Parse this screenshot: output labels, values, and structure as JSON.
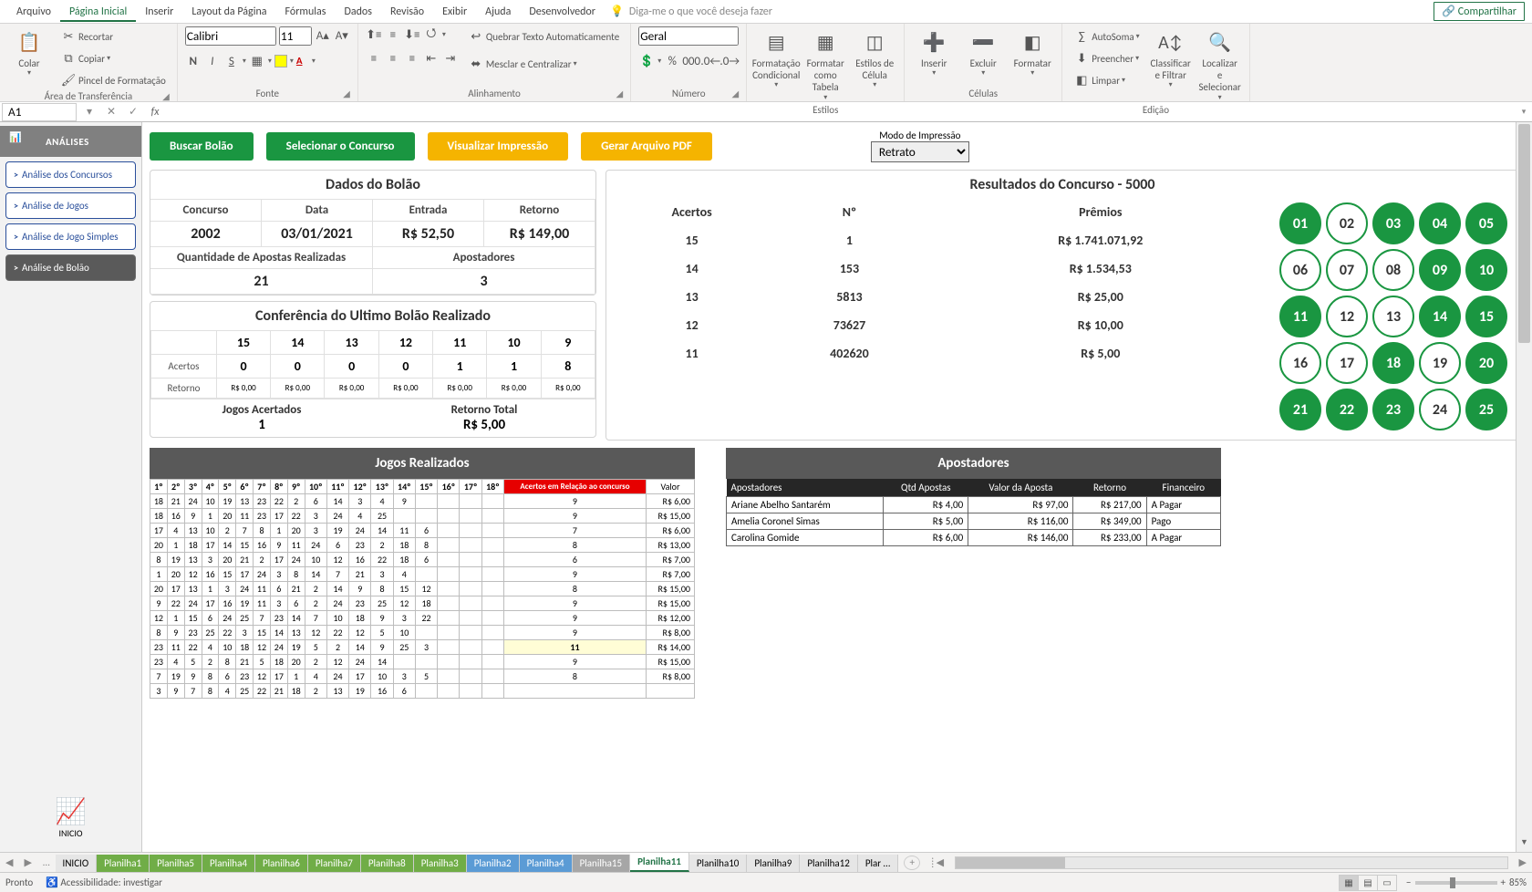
{
  "menubar": {
    "tabs": [
      "Arquivo",
      "Página Inicial",
      "Inserir",
      "Layout da Página",
      "Fórmulas",
      "Dados",
      "Revisão",
      "Exibir",
      "Ajuda",
      "Desenvolvedor"
    ],
    "active": 1,
    "tellme": "Diga-me o que você deseja fazer",
    "share": "Compartilhar"
  },
  "ribbon": {
    "paste": "Colar",
    "cut": "Recortar",
    "copy": "Copiar",
    "fmtpaint": "Pincel de Formatação",
    "grp_clipboard": "Área de Transferência",
    "font_name": "Calibri",
    "font_size": "11",
    "grp_font": "Fonte",
    "wrap": "Quebrar Texto Automaticamente",
    "merge": "Mesclar e Centralizar",
    "grp_align": "Alinhamento",
    "numfmt": "Geral",
    "grp_number": "Número",
    "condfmt": "Formatação Condicional",
    "fmttable": "Formatar como Tabela",
    "cellstyle": "Estilos de Célula",
    "grp_styles": "Estilos",
    "insert": "Inserir",
    "delete": "Excluir",
    "format": "Formatar",
    "grp_cells": "Células",
    "autosum": "AutoSoma",
    "fill": "Preencher",
    "clear": "Limpar",
    "sortfilter": "Classificar e Filtrar",
    "findsel": "Localizar e Selecionar",
    "grp_edit": "Edição"
  },
  "formula": {
    "namebox": "A1"
  },
  "sidebar": {
    "title": "ANÁLISES",
    "items": [
      "Análise dos Concursos",
      "Análise de Jogos",
      "Análise de Jogo Simples",
      "Análise de Bolão"
    ],
    "active": 3,
    "inicio": "INICIO"
  },
  "toprow": {
    "buscar": "Buscar Bolão",
    "selecionar": "Selecionar o Concurso",
    "visualizar": "Visualizar Impressão",
    "gerar": "Gerar Arquivo PDF",
    "printmode_label": "Modo de Impressão",
    "printmode_value": "Retrato"
  },
  "bolao": {
    "title": "Dados do Bolão",
    "h_concurso": "Concurso",
    "v_concurso": "2002",
    "h_data": "Data",
    "v_data": "03/01/2021",
    "h_entrada": "Entrada",
    "v_entrada": "R$ 52,50",
    "h_retorno": "Retorno",
    "v_retorno": "R$ 149,00",
    "h_qtd": "Quantidade de Apostas Realizadas",
    "v_qtd": "21",
    "h_apost": "Apostadores",
    "v_apost": "3"
  },
  "conf": {
    "title": "Conferência do Ultimo Bolão Realizado",
    "cols": [
      "15",
      "14",
      "13",
      "12",
      "11",
      "10",
      "9"
    ],
    "row_acertos_label": "Acertos",
    "row_acertos": [
      "0",
      "0",
      "0",
      "0",
      "1",
      "1",
      "8"
    ],
    "row_retorno_label": "Retorno",
    "row_retorno": [
      "R$ 0,00",
      "R$ 0,00",
      "R$ 0,00",
      "R$ 0,00",
      "R$ 0,00",
      "R$ 0,00",
      "R$ 0,00"
    ],
    "foot1_t": "Jogos Acertados",
    "foot1_v": "1",
    "foot2_t": "Retorno Total",
    "foot2_v": "R$ 5,00"
  },
  "result": {
    "title": "Resultados do Concurso - 5000",
    "h_acertos": "Acertos",
    "h_num": "Nº",
    "h_premios": "Prêmios",
    "rows": [
      {
        "a": "15",
        "n": "1",
        "p": "R$ 1.741.071,92"
      },
      {
        "a": "14",
        "n": "153",
        "p": "R$ 1.534,53"
      },
      {
        "a": "13",
        "n": "5813",
        "p": "R$ 25,00"
      },
      {
        "a": "12",
        "n": "73627",
        "p": "R$ 10,00"
      },
      {
        "a": "11",
        "n": "402620",
        "p": "R$ 5,00"
      }
    ],
    "balls_on": [
      1,
      3,
      4,
      5,
      9,
      10,
      11,
      14,
      15,
      18,
      20,
      21,
      22,
      23,
      25
    ]
  },
  "jogos": {
    "title": "Jogos Realizados",
    "ordinals": [
      "1º",
      "2º",
      "3º",
      "4º",
      "5º",
      "6º",
      "7º",
      "8º",
      "9º",
      "10º",
      "11º",
      "12º",
      "13º",
      "14º",
      "15º",
      "16º",
      "17º",
      "18º"
    ],
    "redhdr": "Acertos em Relação ao concurso",
    "valhdr": "Valor",
    "rows": [
      {
        "n": [
          "18",
          "21",
          "24",
          "10",
          "19",
          "13",
          "23",
          "22",
          "2",
          "6",
          "14",
          "3",
          "4",
          "9",
          "",
          "",
          "",
          ""
        ],
        "a": "9",
        "v": "R$ 6,00"
      },
      {
        "n": [
          "18",
          "16",
          "9",
          "1",
          "20",
          "11",
          "23",
          "17",
          "22",
          "3",
          "24",
          "4",
          "25",
          "",
          "",
          "",
          "",
          ""
        ],
        "a": "9",
        "v": "R$ 15,00"
      },
      {
        "n": [
          "17",
          "4",
          "13",
          "10",
          "2",
          "7",
          "8",
          "1",
          "20",
          "3",
          "19",
          "24",
          "14",
          "11",
          "6",
          "",
          "",
          ""
        ],
        "a": "7",
        "v": "R$ 6,00"
      },
      {
        "n": [
          "20",
          "1",
          "18",
          "17",
          "14",
          "15",
          "16",
          "9",
          "11",
          "24",
          "6",
          "23",
          "2",
          "18",
          "8",
          "",
          "",
          ""
        ],
        "a": "8",
        "v": "R$ 13,00"
      },
      {
        "n": [
          "8",
          "19",
          "13",
          "3",
          "20",
          "21",
          "2",
          "17",
          "24",
          "10",
          "12",
          "16",
          "22",
          "18",
          "6",
          "",
          "",
          ""
        ],
        "a": "6",
        "v": "R$ 7,00"
      },
      {
        "n": [
          "1",
          "20",
          "12",
          "16",
          "15",
          "17",
          "24",
          "3",
          "8",
          "14",
          "7",
          "21",
          "3",
          "4",
          "",
          "",
          "",
          ""
        ],
        "a": "9",
        "v": "R$ 7,00"
      },
      {
        "n": [
          "20",
          "17",
          "13",
          "1",
          "3",
          "24",
          "11",
          "6",
          "21",
          "2",
          "14",
          "9",
          "8",
          "15",
          "12",
          "",
          "",
          ""
        ],
        "a": "8",
        "v": "R$ 15,00"
      },
      {
        "n": [
          "9",
          "22",
          "24",
          "17",
          "16",
          "19",
          "11",
          "3",
          "6",
          "2",
          "24",
          "23",
          "25",
          "12",
          "18",
          "",
          "",
          ""
        ],
        "a": "9",
        "v": "R$ 15,00"
      },
      {
        "n": [
          "12",
          "1",
          "15",
          "6",
          "24",
          "25",
          "7",
          "23",
          "14",
          "7",
          "10",
          "18",
          "9",
          "3",
          "22",
          "",
          "",
          ""
        ],
        "a": "9",
        "v": "R$ 12,00"
      },
      {
        "n": [
          "8",
          "9",
          "23",
          "25",
          "22",
          "3",
          "15",
          "14",
          "13",
          "12",
          "22",
          "12",
          "5",
          "10",
          "",
          "",
          "",
          ""
        ],
        "a": "9",
        "v": "R$ 8,00"
      },
      {
        "n": [
          "23",
          "11",
          "22",
          "4",
          "10",
          "18",
          "12",
          "24",
          "19",
          "5",
          "2",
          "14",
          "9",
          "25",
          "3",
          "",
          "",
          ""
        ],
        "a": "11",
        "v": "R$ 14,00",
        "hl": true
      },
      {
        "n": [
          "23",
          "4",
          "5",
          "2",
          "8",
          "21",
          "5",
          "18",
          "20",
          "2",
          "12",
          "24",
          "14",
          "",
          "",
          "",
          "",
          ""
        ],
        "a": "9",
        "v": "R$ 15,00"
      },
      {
        "n": [
          "7",
          "19",
          "9",
          "8",
          "6",
          "23",
          "12",
          "17",
          "1",
          "4",
          "24",
          "17",
          "10",
          "3",
          "5",
          "",
          "",
          ""
        ],
        "a": "8",
        "v": "R$ 8,00"
      },
      {
        "n": [
          "3",
          "9",
          "7",
          "8",
          "4",
          "25",
          "22",
          "21",
          "18",
          "2",
          "13",
          "19",
          "16",
          "6",
          "",
          "",
          "",
          ""
        ],
        "a": "",
        "v": ""
      }
    ]
  },
  "apost": {
    "title": "Apostadores",
    "headers": [
      "Apostadores",
      "Qtd Apostas",
      "Valor da Aposta",
      "Retorno",
      "Financeiro"
    ],
    "rows": [
      {
        "nome": "Ariane Abelho Santarém",
        "qtd": "",
        "val": "R$ 4,00",
        "ret_ap": "R$ 97,00",
        "ret": "R$ 217,00",
        "fin": "A Pagar"
      },
      {
        "nome": "Amelia Coronel Simas",
        "qtd": "",
        "val": "R$ 5,00",
        "ret_ap": "R$ 116,00",
        "ret": "R$ 349,00",
        "fin": "Pago"
      },
      {
        "nome": "Carolina Gomide",
        "qtd": "",
        "val": "R$ 6,00",
        "ret_ap": "R$ 146,00",
        "ret": "R$ 233,00",
        "fin": "A Pagar"
      }
    ]
  },
  "sheets": {
    "tabs": [
      {
        "name": "INICIO",
        "color": ""
      },
      {
        "name": "Planilha1",
        "color": "green"
      },
      {
        "name": "Planilha5",
        "color": "green"
      },
      {
        "name": "Planilha4",
        "color": "green"
      },
      {
        "name": "Planilha6",
        "color": "green"
      },
      {
        "name": "Planilha7",
        "color": "green"
      },
      {
        "name": "Planilha8",
        "color": "green"
      },
      {
        "name": "Planilha3",
        "color": "green"
      },
      {
        "name": "Planilha2",
        "color": "blue"
      },
      {
        "name": "Planilha4",
        "color": "blue"
      },
      {
        "name": "Planilha15",
        "color": "grey"
      },
      {
        "name": "Planilha11",
        "color": "active"
      },
      {
        "name": "Planilha10",
        "color": ""
      },
      {
        "name": "Planilha9",
        "color": ""
      },
      {
        "name": "Planilha12",
        "color": ""
      },
      {
        "name": "Plar …",
        "color": ""
      }
    ]
  },
  "status": {
    "ready": "Pronto",
    "access": "Acessibilidade: investigar",
    "zoom": "85%"
  }
}
